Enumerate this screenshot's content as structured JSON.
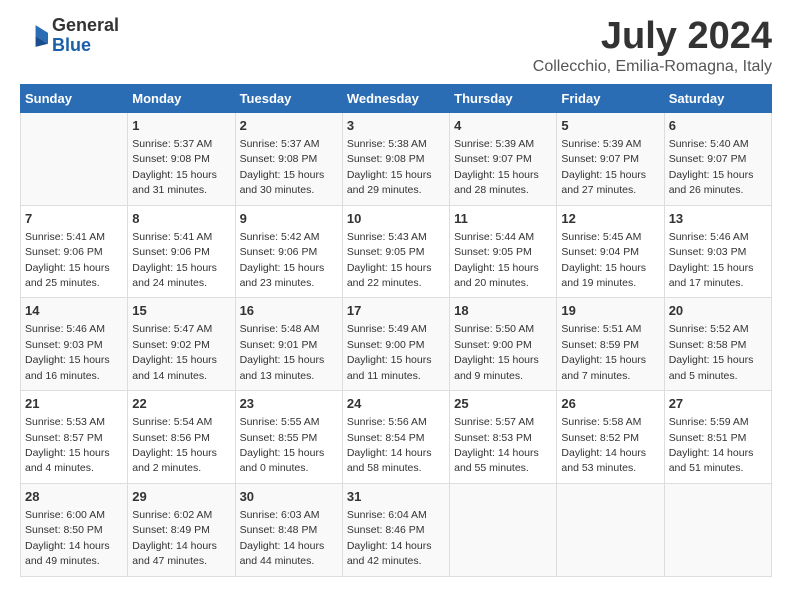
{
  "header": {
    "logo_general": "General",
    "logo_blue": "Blue",
    "title": "July 2024",
    "subtitle": "Collecchio, Emilia-Romagna, Italy"
  },
  "days_of_week": [
    "Sunday",
    "Monday",
    "Tuesday",
    "Wednesday",
    "Thursday",
    "Friday",
    "Saturday"
  ],
  "weeks": [
    [
      {
        "day": "",
        "info": ""
      },
      {
        "day": "1",
        "info": "Sunrise: 5:37 AM\nSunset: 9:08 PM\nDaylight: 15 hours\nand 31 minutes."
      },
      {
        "day": "2",
        "info": "Sunrise: 5:37 AM\nSunset: 9:08 PM\nDaylight: 15 hours\nand 30 minutes."
      },
      {
        "day": "3",
        "info": "Sunrise: 5:38 AM\nSunset: 9:08 PM\nDaylight: 15 hours\nand 29 minutes."
      },
      {
        "day": "4",
        "info": "Sunrise: 5:39 AM\nSunset: 9:07 PM\nDaylight: 15 hours\nand 28 minutes."
      },
      {
        "day": "5",
        "info": "Sunrise: 5:39 AM\nSunset: 9:07 PM\nDaylight: 15 hours\nand 27 minutes."
      },
      {
        "day": "6",
        "info": "Sunrise: 5:40 AM\nSunset: 9:07 PM\nDaylight: 15 hours\nand 26 minutes."
      }
    ],
    [
      {
        "day": "7",
        "info": "Sunrise: 5:41 AM\nSunset: 9:06 PM\nDaylight: 15 hours\nand 25 minutes."
      },
      {
        "day": "8",
        "info": "Sunrise: 5:41 AM\nSunset: 9:06 PM\nDaylight: 15 hours\nand 24 minutes."
      },
      {
        "day": "9",
        "info": "Sunrise: 5:42 AM\nSunset: 9:06 PM\nDaylight: 15 hours\nand 23 minutes."
      },
      {
        "day": "10",
        "info": "Sunrise: 5:43 AM\nSunset: 9:05 PM\nDaylight: 15 hours\nand 22 minutes."
      },
      {
        "day": "11",
        "info": "Sunrise: 5:44 AM\nSunset: 9:05 PM\nDaylight: 15 hours\nand 20 minutes."
      },
      {
        "day": "12",
        "info": "Sunrise: 5:45 AM\nSunset: 9:04 PM\nDaylight: 15 hours\nand 19 minutes."
      },
      {
        "day": "13",
        "info": "Sunrise: 5:46 AM\nSunset: 9:03 PM\nDaylight: 15 hours\nand 17 minutes."
      }
    ],
    [
      {
        "day": "14",
        "info": "Sunrise: 5:46 AM\nSunset: 9:03 PM\nDaylight: 15 hours\nand 16 minutes."
      },
      {
        "day": "15",
        "info": "Sunrise: 5:47 AM\nSunset: 9:02 PM\nDaylight: 15 hours\nand 14 minutes."
      },
      {
        "day": "16",
        "info": "Sunrise: 5:48 AM\nSunset: 9:01 PM\nDaylight: 15 hours\nand 13 minutes."
      },
      {
        "day": "17",
        "info": "Sunrise: 5:49 AM\nSunset: 9:00 PM\nDaylight: 15 hours\nand 11 minutes."
      },
      {
        "day": "18",
        "info": "Sunrise: 5:50 AM\nSunset: 9:00 PM\nDaylight: 15 hours\nand 9 minutes."
      },
      {
        "day": "19",
        "info": "Sunrise: 5:51 AM\nSunset: 8:59 PM\nDaylight: 15 hours\nand 7 minutes."
      },
      {
        "day": "20",
        "info": "Sunrise: 5:52 AM\nSunset: 8:58 PM\nDaylight: 15 hours\nand 5 minutes."
      }
    ],
    [
      {
        "day": "21",
        "info": "Sunrise: 5:53 AM\nSunset: 8:57 PM\nDaylight: 15 hours\nand 4 minutes."
      },
      {
        "day": "22",
        "info": "Sunrise: 5:54 AM\nSunset: 8:56 PM\nDaylight: 15 hours\nand 2 minutes."
      },
      {
        "day": "23",
        "info": "Sunrise: 5:55 AM\nSunset: 8:55 PM\nDaylight: 15 hours\nand 0 minutes."
      },
      {
        "day": "24",
        "info": "Sunrise: 5:56 AM\nSunset: 8:54 PM\nDaylight: 14 hours\nand 58 minutes."
      },
      {
        "day": "25",
        "info": "Sunrise: 5:57 AM\nSunset: 8:53 PM\nDaylight: 14 hours\nand 55 minutes."
      },
      {
        "day": "26",
        "info": "Sunrise: 5:58 AM\nSunset: 8:52 PM\nDaylight: 14 hours\nand 53 minutes."
      },
      {
        "day": "27",
        "info": "Sunrise: 5:59 AM\nSunset: 8:51 PM\nDaylight: 14 hours\nand 51 minutes."
      }
    ],
    [
      {
        "day": "28",
        "info": "Sunrise: 6:00 AM\nSunset: 8:50 PM\nDaylight: 14 hours\nand 49 minutes."
      },
      {
        "day": "29",
        "info": "Sunrise: 6:02 AM\nSunset: 8:49 PM\nDaylight: 14 hours\nand 47 minutes."
      },
      {
        "day": "30",
        "info": "Sunrise: 6:03 AM\nSunset: 8:48 PM\nDaylight: 14 hours\nand 44 minutes."
      },
      {
        "day": "31",
        "info": "Sunrise: 6:04 AM\nSunset: 8:46 PM\nDaylight: 14 hours\nand 42 minutes."
      },
      {
        "day": "",
        "info": ""
      },
      {
        "day": "",
        "info": ""
      },
      {
        "day": "",
        "info": ""
      }
    ]
  ]
}
